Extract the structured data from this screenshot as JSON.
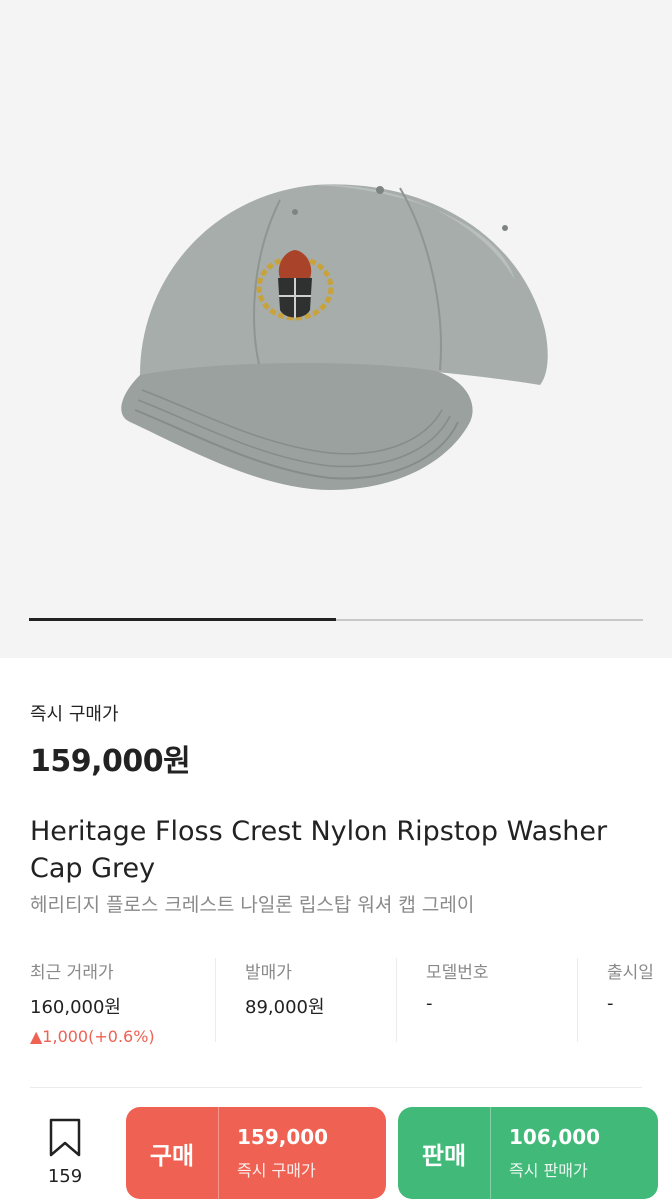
{
  "product": {
    "image_icon": "cap-image",
    "carousel_progress": 0.5
  },
  "price": {
    "label": "즉시 구매가",
    "value": "159,000원"
  },
  "title": {
    "en": "Heritage Floss Crest Nylon Ripstop Washer Cap Grey",
    "ko": "헤리티지 플로스 크레스트 나일론 립스탑 워셔 캡 그레이"
  },
  "stats": {
    "recent": {
      "label": "최근 거래가",
      "value": "160,000원",
      "change": "▲1,000(+0.6%)"
    },
    "release_price": {
      "label": "발매가",
      "value": "89,000원"
    },
    "model": {
      "label": "모델번호",
      "value": "-"
    },
    "release_date": {
      "label": "출시일",
      "value": "-"
    }
  },
  "bottom_bar": {
    "bookmark_icon": "bookmark-icon",
    "bookmark_count": "159",
    "buy": {
      "label": "구매",
      "amount": "159,000",
      "sub": "즉시 구매가",
      "color": "#ef6253"
    },
    "sell": {
      "label": "판매",
      "amount": "106,000",
      "sub": "즉시 판매가",
      "color": "#41b979"
    }
  }
}
